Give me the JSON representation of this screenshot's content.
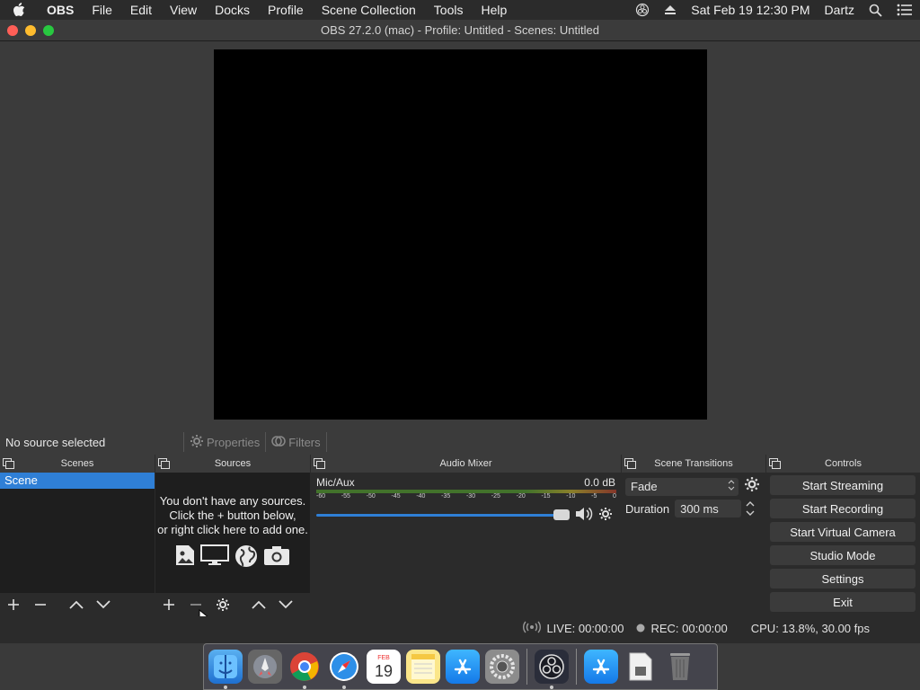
{
  "menubar": {
    "app_name": "OBS",
    "items": [
      "File",
      "Edit",
      "View",
      "Docks",
      "Profile",
      "Scene Collection",
      "Tools",
      "Help"
    ],
    "datetime": "Sat Feb 19  12:30 PM",
    "user": "Dartz"
  },
  "window": {
    "title": "OBS 27.2.0 (mac) - Profile: Untitled - Scenes: Untitled"
  },
  "source_bar": {
    "no_selection": "No source selected",
    "properties_label": "Properties",
    "filters_label": "Filters"
  },
  "docks": {
    "scenes": {
      "title": "Scenes",
      "items": [
        "Scene"
      ]
    },
    "sources": {
      "title": "Sources",
      "empty_line1": "You don't have any sources.",
      "empty_line2": "Click the + button below,",
      "empty_line3": "or right click here to add one."
    },
    "mixer": {
      "title": "Audio Mixer",
      "channel_name": "Mic/Aux",
      "channel_db": "0.0 dB",
      "ticks": [
        "-60",
        "-55",
        "-50",
        "-45",
        "-40",
        "-35",
        "-30",
        "-25",
        "-20",
        "-15",
        "-10",
        "-5",
        "0"
      ],
      "volume": 1.0
    },
    "transitions": {
      "title": "Scene Transitions",
      "selected": "Fade",
      "duration_label": "Duration",
      "duration_value": "300 ms"
    },
    "controls": {
      "title": "Controls",
      "start_streaming": "Start Streaming",
      "start_recording": "Start Recording",
      "start_virtual_camera": "Start Virtual Camera",
      "studio_mode": "Studio Mode",
      "settings": "Settings",
      "exit": "Exit"
    }
  },
  "status": {
    "live": "LIVE: 00:00:00",
    "rec": "REC: 00:00:00",
    "cpu": "CPU: 13.8%, 30.00 fps"
  },
  "dock_apps": {
    "calendar_month": "FEB",
    "calendar_day": "19"
  }
}
